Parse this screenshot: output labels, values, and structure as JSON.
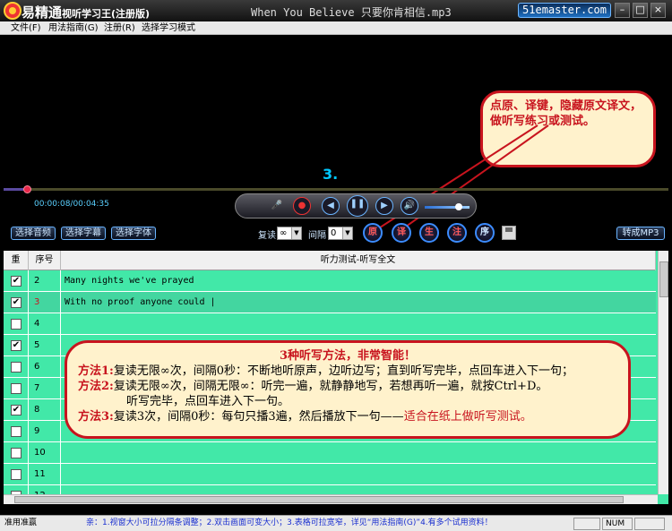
{
  "window": {
    "app_title": "易精通",
    "app_subtitle": "视听学习王(注册版)",
    "file_title": "When You Believe 只要你肯相信.mp3",
    "site_badge": "51emaster.com"
  },
  "menu": [
    "文件(F)",
    "用法指南(G)",
    "注册(R)",
    "选择学习模式"
  ],
  "player": {
    "subtitle_index": "3.",
    "time": "00:00:08/00:04:35",
    "progress": 0.03,
    "volume": 0.75
  },
  "controls": {
    "select_audio": "选择音频",
    "select_subtitle": "选择字幕",
    "select_font": "选择字体",
    "repeat_label": "复读",
    "repeat_value": "∞",
    "interval_label": "间隔",
    "interval_value": "0",
    "btn_yuan": "原",
    "btn_yi": "译",
    "btn_sheng": "生",
    "btn_zhu": "注",
    "btn_xu": "序",
    "convert_mp3": "转成MP3"
  },
  "callout_top": "点原、译键，隐藏原文译文，做听写练习或测试。",
  "table": {
    "headers": [
      "重",
      "序号",
      "听力测试-听写全文"
    ],
    "rows": [
      {
        "checked": true,
        "index": "2",
        "text": "Many nights we've prayed",
        "idx_color": "#000000"
      },
      {
        "checked": true,
        "index": "3",
        "text": "With no proof anyone could |",
        "idx_color": "#c8141e"
      },
      {
        "checked": false,
        "index": "4",
        "text": "",
        "idx_color": "#000000"
      },
      {
        "checked": true,
        "index": "5",
        "text": "",
        "idx_color": "#000000"
      },
      {
        "checked": false,
        "index": "6",
        "text": "",
        "idx_color": "#000000"
      },
      {
        "checked": false,
        "index": "7",
        "text": "",
        "idx_color": "#000000"
      },
      {
        "checked": true,
        "index": "8",
        "text": "",
        "idx_color": "#000000"
      },
      {
        "checked": false,
        "index": "9",
        "text": "",
        "idx_color": "#000000"
      },
      {
        "checked": false,
        "index": "10",
        "text": "",
        "idx_color": "#000000"
      },
      {
        "checked": false,
        "index": "11",
        "text": "",
        "idx_color": "#000000"
      },
      {
        "checked": false,
        "index": "12",
        "text": "",
        "idx_color": "#000000"
      }
    ]
  },
  "callout_bottom": {
    "title": "3种听写方法，非常智能！",
    "m1_label": "方法1:",
    "m1_text": "复读无限∞次，间隔0秒：不断地听原声，边听边写；直到听写完毕，点回车进入下一句；",
    "m2_label": "方法2:",
    "m2_text": "复读无限∞次，间隔无限∞：听完一遍，就静静地写，若想再听一遍，就按Ctrl+D。",
    "m2_cont": "听写完毕，点回车进入下一句。",
    "m3_label": "方法3:",
    "m3_text": "复读3次，间隔0秒：每句只播3遍，然后播放下一句——",
    "m3_red": "适合在纸上做听写测试。"
  },
  "status": {
    "left": "准用准赢",
    "tip": "亲：1.视窗大小可拉分隔条调整；2.双击画面可变大小；3.表格可拉宽窄，详见“用法指南(G)”4.有多个试用资料！",
    "num": "NUM"
  },
  "colors": {
    "accent_red": "#c8141e",
    "table_bg": "#42e8a8",
    "callout_bg": "#fff2cc"
  }
}
